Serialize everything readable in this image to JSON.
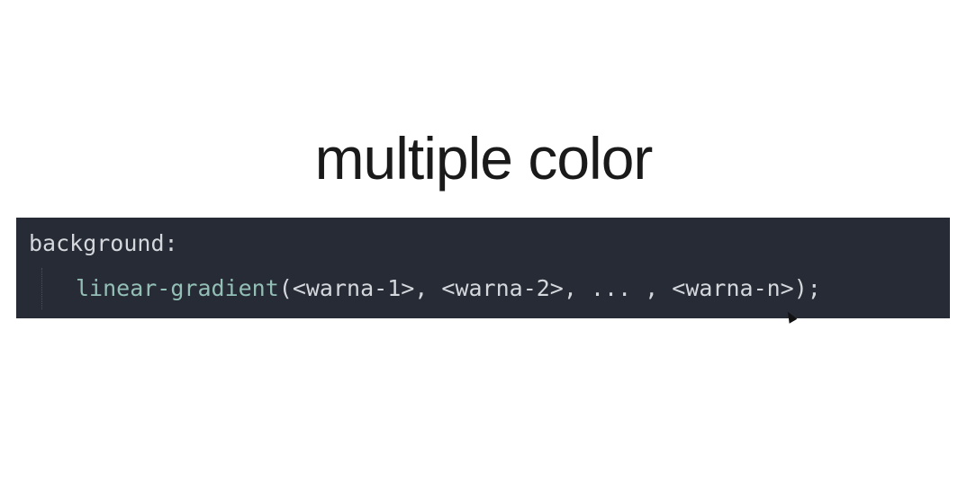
{
  "slide": {
    "title": "multiple color",
    "code": {
      "property": "background:",
      "function_name": "linear-gradient",
      "arguments": "(<warna-1>, <warna-2>, ... , <warna-n>);"
    }
  },
  "colors": {
    "code_background": "#272b35",
    "code_text": "#d4d7dc",
    "function_color": "#93bfb6"
  }
}
